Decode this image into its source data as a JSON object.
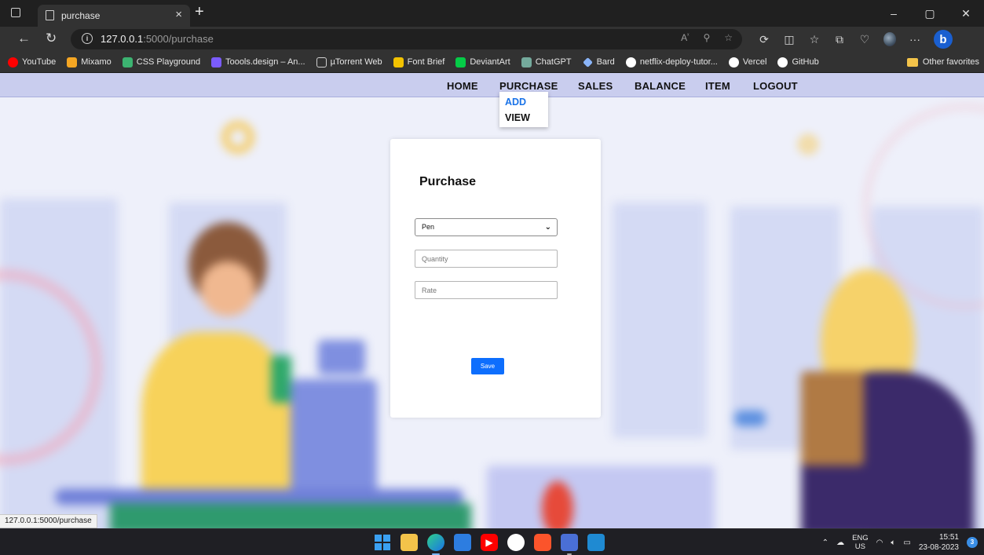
{
  "browser": {
    "tab_title": "purchase",
    "tab_close": "×",
    "new_tab": "+",
    "window_controls": [
      "–",
      "▢",
      "✕"
    ],
    "url_host": "127.0.0.1",
    "url_path": ":5000/purchase",
    "bookmarks": [
      {
        "label": "YouTube",
        "color": "#ff0000"
      },
      {
        "label": "Mixamo",
        "color": "#f5a623"
      },
      {
        "label": "CSS Playground",
        "color": "#3cb371"
      },
      {
        "label": "Toools.design – An...",
        "color": "#7b5cff"
      },
      {
        "label": "µTorrent Web",
        "color": "#d0d0d0"
      },
      {
        "label": "Font Brief",
        "color": "#f2c200"
      },
      {
        "label": "DeviantArt",
        "color": "#05cc47"
      },
      {
        "label": "ChatGPT",
        "color": "#74aa9c"
      },
      {
        "label": "Bard",
        "color": "#8ab4f8"
      },
      {
        "label": "netflix-deploy-tutor...",
        "color": "#ffffff"
      },
      {
        "label": "Vercel",
        "color": "#ffffff"
      },
      {
        "label": "GitHub",
        "color": "#ffffff"
      }
    ],
    "other_favorites": "Other favorites",
    "status_url": "127.0.0.1:5000/purchase"
  },
  "navbar": {
    "items": [
      "HOME",
      "PURCHASE",
      "SALES",
      "BALANCE",
      "ITEM",
      "LOGOUT"
    ],
    "dropdown": {
      "add": "ADD",
      "view": "VIEW",
      "active_color": "#1a73e8"
    }
  },
  "form": {
    "title": "Purchase",
    "item_selected": "Pen",
    "quantity_placeholder": "Quantity",
    "rate_placeholder": "Rate",
    "save_label": "Save",
    "accent": "#0d6efd"
  },
  "taskbar": {
    "lang_top": "ENG",
    "lang_bottom": "US",
    "time": "15:51",
    "date": "23-08-2023",
    "notifications": "3"
  }
}
